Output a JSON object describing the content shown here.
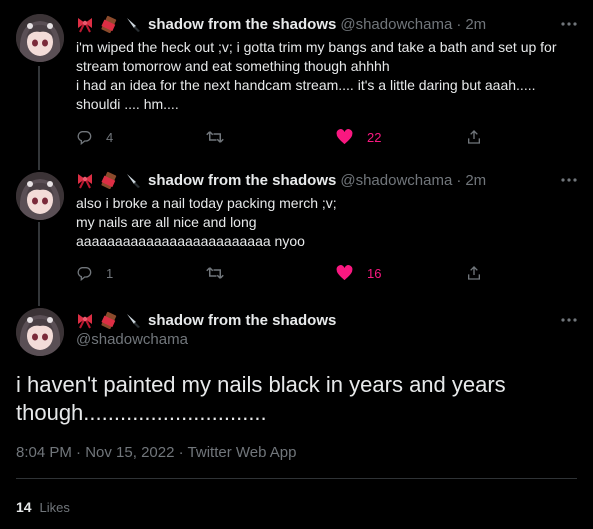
{
  "author": {
    "name": "shadow from the shadows",
    "handle": "@shadowchama"
  },
  "tweets": [
    {
      "time": "2m",
      "text": "i'm wiped the heck out ;v; i gotta trim my bangs and take a bath and set up for stream tomorrow and eat something though ahhhh\ni had an idea for the next handcam stream.... it's a little daring but aaah.....\nshouldi .... hm....",
      "replies": "4",
      "retweets": "",
      "likes": "22"
    },
    {
      "time": "2m",
      "text": "also i broke a nail today packing merch ;v;\nmy nails are all nice and long\naaaaaaaaaaaaaaaaaaaaaaaaa nyoo",
      "replies": "1",
      "retweets": "",
      "likes": "16"
    }
  ],
  "main_tweet": {
    "text": "i haven't painted my nails black in years and years though..............................",
    "time": "8:04 PM",
    "date": "Nov 15, 2022",
    "source": "Twitter Web App",
    "like_count": "14",
    "likes_label": "Likes"
  },
  "separator": "·",
  "icons": {
    "reply": "reply-icon",
    "retweet": "retweet-icon",
    "like": "heart-icon",
    "share": "share-icon",
    "more": "more-icon"
  },
  "colors": {
    "background": "#000000",
    "text": "#e7e9ea",
    "secondary": "#71767b",
    "like": "#f91880",
    "divider": "#2f3336"
  }
}
